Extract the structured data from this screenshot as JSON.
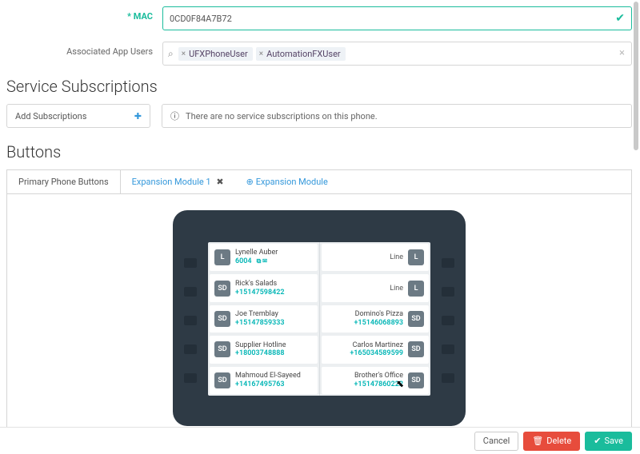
{
  "form": {
    "mac_label": "MAC",
    "mac_value": "0CD0F84A7B72",
    "assoc_label": "Associated App Users",
    "chips": [
      "UFXPhoneUser",
      "AutomationFXUser"
    ]
  },
  "subs": {
    "heading": "Service Subscriptions",
    "add_label": "Add Subscriptions",
    "empty_msg": "There are no service subscriptions on this phone."
  },
  "buttons": {
    "heading": "Buttons",
    "tab_primary": "Primary Phone Buttons",
    "tab_module1": "Expansion Module 1",
    "tab_add": "Expansion Module"
  },
  "phone": {
    "left": [
      {
        "badge": "L",
        "name": "Lynelle Auber",
        "num": "6004",
        "icons": true
      },
      {
        "badge": "SD",
        "name": "Rick's Salads",
        "num": "+15147598422"
      },
      {
        "badge": "SD",
        "name": "Joe Tremblay",
        "num": "+15147859333"
      },
      {
        "badge": "SD",
        "name": "Supplier Hotline",
        "num": "+18003748888"
      },
      {
        "badge": "SD",
        "name": "Mahmoud El-Sayeed",
        "num": "+14167495763"
      }
    ],
    "right": [
      {
        "badge": "L",
        "label": "Line"
      },
      {
        "badge": "L",
        "label": "Line"
      },
      {
        "badge": "SD",
        "name": "Domino's Pizza",
        "num": "+15146068893"
      },
      {
        "badge": "SD",
        "name": "Carlos Martinez",
        "num": "+165034589599"
      },
      {
        "badge": "SD",
        "name": "Brother's Office",
        "num": "+15147860222"
      }
    ]
  },
  "footer": {
    "cancel": "Cancel",
    "delete": "Delete",
    "save": "Save"
  }
}
